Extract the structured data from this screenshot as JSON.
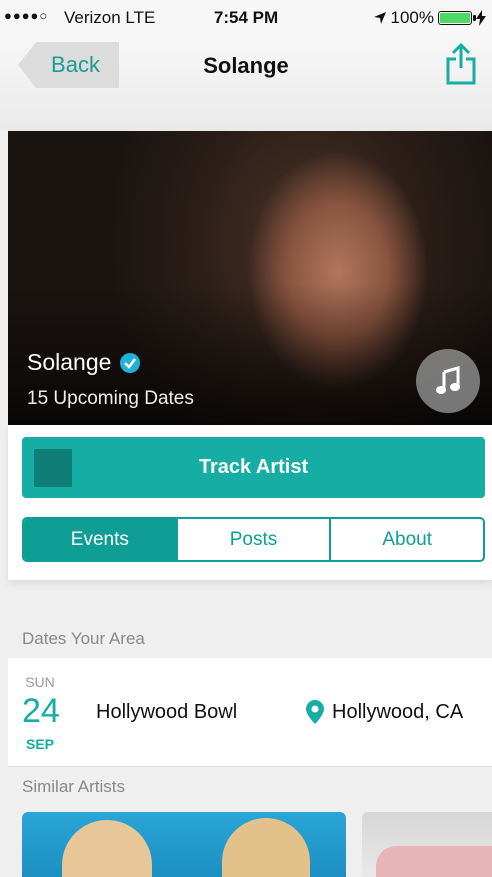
{
  "status_bar": {
    "signal": "●●●●○",
    "carrier": "Verizon  LTE",
    "time": "7:54 PM",
    "battery": "100%",
    "battery_level": 1.0
  },
  "nav": {
    "back_label": "Back",
    "title": "Solange"
  },
  "artist": {
    "name": "Solange",
    "upcoming": "15 Upcoming Dates"
  },
  "actions": {
    "track_label": "Track Artist"
  },
  "tabs": [
    {
      "label": "Events",
      "active": true
    },
    {
      "label": "Posts",
      "active": false
    },
    {
      "label": "About",
      "active": false
    }
  ],
  "sections": {
    "dates_label": "Dates Your Area",
    "similar_label": "Similar Artists"
  },
  "event": {
    "day_of_week": "SUN",
    "day": "24",
    "month": "SEP",
    "venue": "Hollywood Bowl",
    "location": "Hollywood, CA"
  },
  "colors": {
    "accent": "#16ada4",
    "accent_dark": "#0f9e96"
  }
}
